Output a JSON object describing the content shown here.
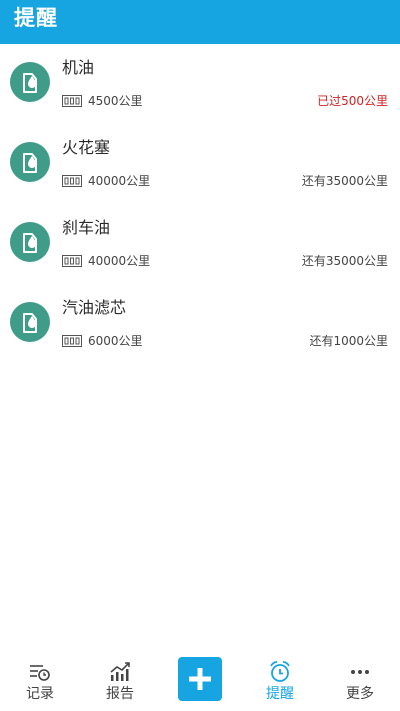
{
  "header": {
    "title": "提醒"
  },
  "reminders": [
    {
      "name": "机油",
      "interval": "4500公里",
      "status": "已过500公里",
      "overdue": true
    },
    {
      "name": "火花塞",
      "interval": "40000公里",
      "status": "还有35000公里",
      "overdue": false
    },
    {
      "name": "刹车油",
      "interval": "40000公里",
      "status": "还有35000公里",
      "overdue": false
    },
    {
      "name": "汽油滤芯",
      "interval": "6000公里",
      "status": "还有1000公里",
      "overdue": false
    }
  ],
  "tabbar": {
    "tabs": [
      {
        "label": "记录",
        "icon": "record-list-icon"
      },
      {
        "label": "报告",
        "icon": "report-chart-icon"
      },
      {
        "label": "",
        "icon": "plus-icon"
      },
      {
        "label": "提醒",
        "icon": "alarm-clock-icon",
        "active": true
      },
      {
        "label": "更多",
        "icon": "more-dots-icon"
      }
    ]
  },
  "colors": {
    "accent": "#16a5e0",
    "icon_bg": "#3e9c88",
    "overdue": "#cf2323"
  }
}
